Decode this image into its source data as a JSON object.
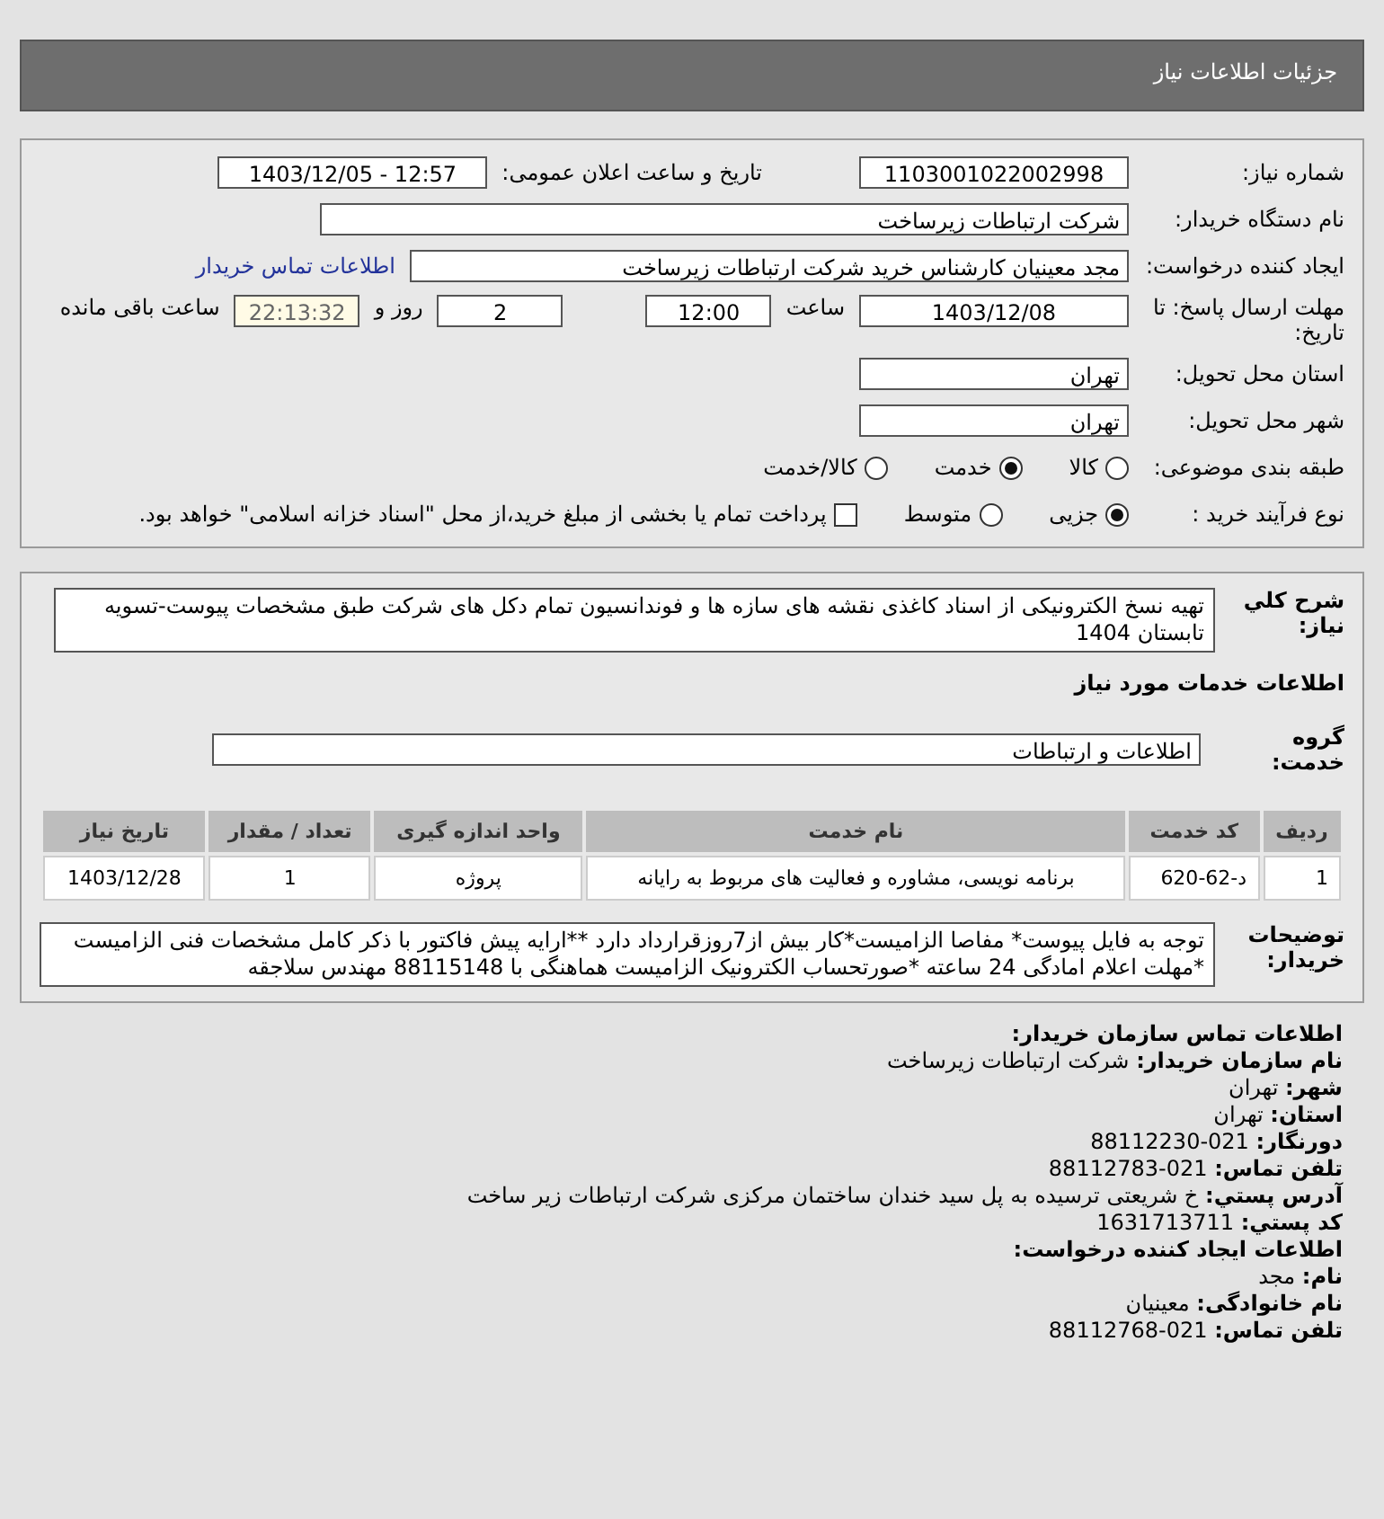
{
  "header": {
    "title": "جزئیات اطلاعات نیاز"
  },
  "details": {
    "need_number": {
      "label": "شماره نیاز:",
      "value": "1103001022002998"
    },
    "announce": {
      "label": "تاریخ و ساعت اعلان عمومی:",
      "value": "1403/12/05 - 12:57"
    },
    "buyer": {
      "label": "نام دستگاه خریدار:",
      "value": "شرکت ارتباطات زیرساخت"
    },
    "creator": {
      "label": "ایجاد کننده درخواست:",
      "value": "مجد معینیان کارشناس خرید شرکت ارتباطات زیرساخت",
      "link": "اطلاعات تماس خریدار"
    },
    "deadline": {
      "label": "مهلت ارسال پاسخ: تا تاریخ:",
      "date": "1403/12/08",
      "time_label": "ساعت",
      "time": "12:00",
      "days": "2",
      "days_label": "روز و",
      "remaining": "22:13:32",
      "remaining_label": "ساعت باقی مانده"
    },
    "province": {
      "label": "استان محل تحویل:",
      "value": "تهران"
    },
    "city": {
      "label": "شهر محل تحویل:",
      "value": "تهران"
    },
    "category": {
      "label": "طبقه بندی موضوعی:",
      "options": [
        {
          "label": "کالا",
          "selected": false
        },
        {
          "label": "خدمت",
          "selected": true
        },
        {
          "label": "کالا/خدمت",
          "selected": false
        }
      ]
    },
    "purchase_type": {
      "label": "نوع فرآیند خرید :",
      "options": [
        {
          "label": "جزیی",
          "selected": true
        },
        {
          "label": "متوسط",
          "selected": false
        }
      ],
      "payment": {
        "label": "پرداخت تمام یا بخشی از مبلغ خرید،از محل \"اسناد خزانه اسلامی\" خواهد بود.",
        "checked": false
      }
    }
  },
  "description": {
    "label": "شرح کلي نياز:",
    "value": "تهیه نسخ الکترونیکی از اسناد کاغذی نقشه های سازه ها و فوندانسیون تمام دکل های شرکت طبق مشخصات پیوست-تسویه تابستان 1404"
  },
  "services_title": "اطلاعات خدمات مورد نیاز",
  "service_group": {
    "label": "گروه خدمت:",
    "value": "اطلاعات و ارتباطات"
  },
  "table": {
    "columns": [
      "ردیف",
      "کد خدمت",
      "نام خدمت",
      "واحد اندازه گیری",
      "تعداد / مقدار",
      "تاریخ نیاز"
    ],
    "rows": [
      [
        "1",
        "د-62-620",
        "برنامه نویسی، مشاوره و فعالیت های مربوط به رایانه",
        "پروژه",
        "1",
        "1403/12/28"
      ]
    ]
  },
  "notes": {
    "label": "توضیحات خریدار:",
    "value": "توجه به فایل پیوست* مفاصا الزامیست*کار بیش از7روزقرارداد دارد **ارایه پیش فاکتور با ذکر کامل مشخصات فنی الزامیست *مهلت اعلام امادگی 24 ساعته *صورتحساب الکترونیک الزامیست هماهنگی با 88115148 مهندس سلاجقه"
  },
  "contact": [
    {
      "kind": "heading",
      "label": "اطلاعات تماس سازمان خریدار:"
    },
    {
      "kind": "field",
      "label": "نام سازمان خریدار:",
      "value": "شرکت ارتباطات زیرساخت"
    },
    {
      "kind": "field",
      "label": "شهر:",
      "value": "تهران"
    },
    {
      "kind": "field",
      "label": "استان:",
      "value": "تهران"
    },
    {
      "kind": "field",
      "label": "دورنگار:",
      "value": "88112230-021"
    },
    {
      "kind": "field",
      "label": "تلفن تماس:",
      "value": "88112783-021"
    },
    {
      "kind": "field",
      "label": "آدرس پستي:",
      "value": "خ شریعتی ترسیده به پل سید خندان ساختمان مرکزی شرکت ارتباطات زیر ساخت"
    },
    {
      "kind": "field",
      "label": "کد پستي:",
      "value": "1631713711"
    },
    {
      "kind": "heading",
      "label": "اطلاعات ایجاد کننده درخواست:"
    },
    {
      "kind": "field",
      "label": "نام:",
      "value": "مجد"
    },
    {
      "kind": "field",
      "label": "نام خانوادگی:",
      "value": "معینیان"
    },
    {
      "kind": "field",
      "label": "تلفن تماس:",
      "value": "88112768-021"
    }
  ]
}
